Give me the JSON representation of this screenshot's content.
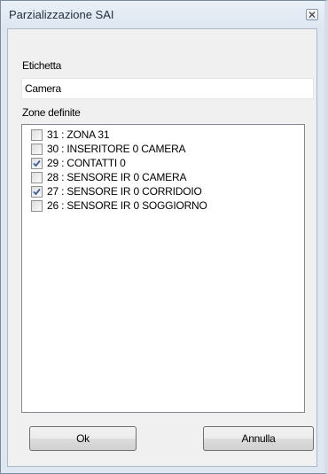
{
  "window": {
    "title": "Parzializzazione SAI",
    "close_icon": "close-icon"
  },
  "form": {
    "label_field_label": "Etichetta",
    "label_value": "Camera",
    "zones_label": "Zone definite"
  },
  "zones": [
    {
      "label": "31 : ZONA 31",
      "checked": false
    },
    {
      "label": "30 : INSERITORE 0 CAMERA",
      "checked": false
    },
    {
      "label": "29 : CONTATTI 0",
      "checked": true
    },
    {
      "label": "28 : SENSORE IR 0 CAMERA",
      "checked": false
    },
    {
      "label": "27 : SENSORE IR 0 CORRIDOIO",
      "checked": true
    },
    {
      "label": "26 : SENSORE IR 0 SOGGIORNO",
      "checked": false
    }
  ],
  "buttons": {
    "ok_label": "Ok",
    "cancel_label": "Annulla"
  },
  "colors": {
    "window_frame": "#dde6f1",
    "checkmark": "#3c5f99"
  }
}
